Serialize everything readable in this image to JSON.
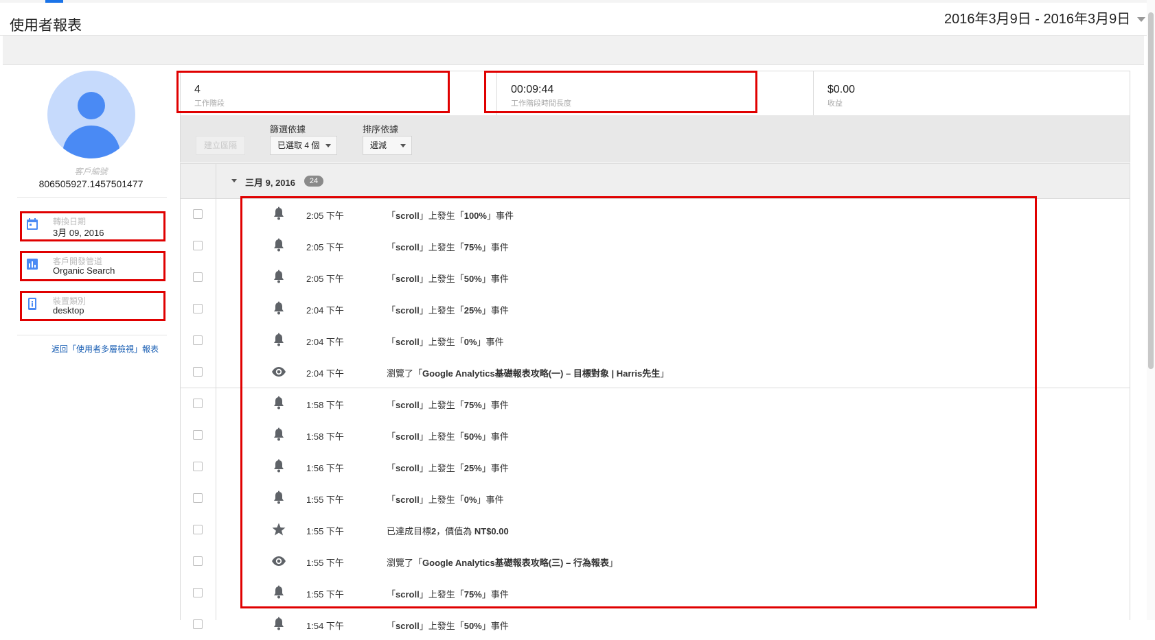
{
  "header": {
    "title": "使用者報表",
    "date_range": "2016年3月9日 - 2016年3月9日"
  },
  "user": {
    "client_id_label": "客戶編號",
    "client_id": "806505927.1457501477",
    "info": [
      {
        "label": "轉換日期",
        "value": "3月 09, 2016",
        "icon": "calendar-icon"
      },
      {
        "label": "客戶開發管道",
        "value": "Organic Search",
        "icon": "channel-chart-icon"
      },
      {
        "label": "裝置類別",
        "value": "desktop",
        "icon": "device-icon"
      }
    ],
    "back_link": "返回「使用者多層檢視」報表"
  },
  "metrics": [
    {
      "value": "4",
      "label": "工作階段"
    },
    {
      "value": "00:09:44",
      "label": "工作階段時間長度"
    },
    {
      "value": "$0.00",
      "label": "收益"
    }
  ],
  "toolbar": {
    "create_segment": "建立區隔",
    "filter_label": "篩選依據",
    "filter_value": "已選取 4 個",
    "sort_label": "排序依據",
    "sort_value": "遞減"
  },
  "timeline": {
    "date": "三月 9, 2016",
    "count": "24",
    "rows": [
      {
        "time": "2:05 下午",
        "icon": "bell-icon",
        "pre": "「",
        "bold": "scroll",
        "mid": "」上發生「",
        "bold2": "100%",
        "post": "」事件"
      },
      {
        "time": "2:05 下午",
        "icon": "bell-icon",
        "pre": "「",
        "bold": "scroll",
        "mid": "」上發生「",
        "bold2": "75%",
        "post": "」事件"
      },
      {
        "time": "2:05 下午",
        "icon": "bell-icon",
        "pre": "「",
        "bold": "scroll",
        "mid": "」上發生「",
        "bold2": "50%",
        "post": "」事件"
      },
      {
        "time": "2:04 下午",
        "icon": "bell-icon",
        "pre": "「",
        "bold": "scroll",
        "mid": "」上發生「",
        "bold2": "25%",
        "post": "」事件"
      },
      {
        "time": "2:04 下午",
        "icon": "bell-icon",
        "pre": "「",
        "bold": "scroll",
        "mid": "」上發生「",
        "bold2": "0%",
        "post": "」事件"
      },
      {
        "time": "2:04 下午",
        "icon": "eye-icon",
        "pre": "瀏覽了「",
        "bold": "Google Analytics基礎報表攻略(一) – 目標對象 | Harris先生",
        "mid": "」",
        "bold2": "",
        "post": ""
      },
      {
        "time": "1:58 下午",
        "icon": "bell-icon",
        "pre": "「",
        "bold": "scroll",
        "mid": "」上發生「",
        "bold2": "75%",
        "post": "」事件"
      },
      {
        "time": "1:58 下午",
        "icon": "bell-icon",
        "pre": "「",
        "bold": "scroll",
        "mid": "」上發生「",
        "bold2": "50%",
        "post": "」事件"
      },
      {
        "time": "1:56 下午",
        "icon": "bell-icon",
        "pre": "「",
        "bold": "scroll",
        "mid": "」上發生「",
        "bold2": "25%",
        "post": "」事件"
      },
      {
        "time": "1:55 下午",
        "icon": "bell-icon",
        "pre": "「",
        "bold": "scroll",
        "mid": "」上發生「",
        "bold2": "0%",
        "post": "」事件"
      },
      {
        "time": "1:55 下午",
        "icon": "star-icon",
        "pre": "已達成目標",
        "bold": "2",
        "mid": "，價值為 ",
        "bold2": "NT$0.00",
        "post": ""
      },
      {
        "time": "1:55 下午",
        "icon": "eye-icon",
        "pre": "瀏覽了「",
        "bold": "Google Analytics基礎報表攻略(三) – 行為報表",
        "mid": "」",
        "bold2": "",
        "post": ""
      },
      {
        "time": "1:55 下午",
        "icon": "bell-icon",
        "pre": "「",
        "bold": "scroll",
        "mid": "」上發生「",
        "bold2": "75%",
        "post": "」事件"
      },
      {
        "time": "1:54 下午",
        "icon": "bell-icon",
        "pre": "「",
        "bold": "scroll",
        "mid": "」上發生「",
        "bold2": "50%",
        "post": "」事件"
      }
    ]
  },
  "colors": {
    "accent": "#1a73e8",
    "icon_blue": "#4a8af4",
    "highlight_red": "#e00000",
    "link": "#1a5fb4"
  }
}
